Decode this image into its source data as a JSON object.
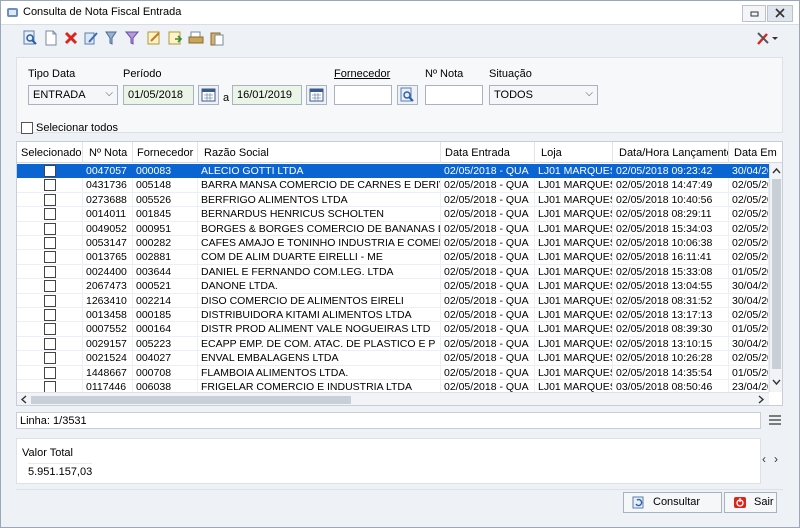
{
  "window": {
    "title": "Consulta de Nota Fiscal Entrada"
  },
  "filters": {
    "tipo_data_label": "Tipo Data",
    "tipo_data_value": "ENTRADA",
    "periodo_label": "Período",
    "periodo_from": "01/05/2018",
    "periodo_sep": "a",
    "periodo_to": "16/01/2019",
    "fornecedor_label": "Fornecedor",
    "fornecedor_value": "",
    "nota_label": "Nº Nota",
    "nota_value": "",
    "situacao_label": "Situação",
    "situacao_value": "TODOS"
  },
  "select_all_label": "Selecionar todos",
  "columns": [
    "Selecionado",
    "Nº Nota",
    "Fornecedor",
    "Razão Social",
    "Data Entrada",
    "Loja",
    "Data/Hora Lançamento",
    "Data Em"
  ],
  "rows": [
    {
      "nota": "0047057",
      "forn": "000083",
      "razao": "ALECIO GOTTI LTDA",
      "entrada": "02/05/2018 - QUA",
      "loja": "LJ01 MARQUES",
      "lanc": "02/05/2018 09:23:42",
      "em": "30/04/20"
    },
    {
      "nota": "0431736",
      "forn": "005148",
      "razao": "BARRA MANSA COMERCIO DE CARNES E DERIVAD",
      "entrada": "02/05/2018 - QUA",
      "loja": "LJ01 MARQUES",
      "lanc": "02/05/2018 14:47:49",
      "em": "02/05/20"
    },
    {
      "nota": "0273688",
      "forn": "005526",
      "razao": "BERFRIGO ALIMENTOS LTDA",
      "entrada": "02/05/2018 - QUA",
      "loja": "LJ01 MARQUES",
      "lanc": "02/05/2018 10:40:56",
      "em": "02/05/20"
    },
    {
      "nota": "0014011",
      "forn": "001845",
      "razao": "BERNARDUS HENRICUS SCHOLTEN",
      "entrada": "02/05/2018 - QUA",
      "loja": "LJ01 MARQUES",
      "lanc": "02/05/2018 08:29:11",
      "em": "02/05/20"
    },
    {
      "nota": "0049052",
      "forn": "000951",
      "razao": "BORGES & BORGES COMERCIO DE BANANAS LTDA",
      "entrada": "02/05/2018 - QUA",
      "loja": "LJ01 MARQUES",
      "lanc": "02/05/2018 15:34:03",
      "em": "02/05/20"
    },
    {
      "nota": "0053147",
      "forn": "000282",
      "razao": "CAFES AMAJO E TONINHO INDUSTRIA E COMERC",
      "entrada": "02/05/2018 - QUA",
      "loja": "LJ01 MARQUES",
      "lanc": "02/05/2018 10:06:38",
      "em": "02/05/20"
    },
    {
      "nota": "0013765",
      "forn": "002881",
      "razao": "COM DE ALIM DUARTE EIRELLI - ME",
      "entrada": "02/05/2018 - QUA",
      "loja": "LJ01 MARQUES",
      "lanc": "02/05/2018 16:11:41",
      "em": "02/05/20"
    },
    {
      "nota": "0024400",
      "forn": "003644",
      "razao": "DANIEL E FERNANDO COM.LEG. LTDA",
      "entrada": "02/05/2018 - QUA",
      "loja": "LJ01 MARQUES",
      "lanc": "02/05/2018 15:33:08",
      "em": "01/05/20"
    },
    {
      "nota": "2067473",
      "forn": "000521",
      "razao": "DANONE LTDA.",
      "entrada": "02/05/2018 - QUA",
      "loja": "LJ01 MARQUES",
      "lanc": "02/05/2018 13:04:55",
      "em": "30/04/20"
    },
    {
      "nota": "1263410",
      "forn": "002214",
      "razao": "DISO COMERCIO DE ALIMENTOS EIRELI",
      "entrada": "02/05/2018 - QUA",
      "loja": "LJ01 MARQUES",
      "lanc": "02/05/2018 08:31:52",
      "em": "30/04/20"
    },
    {
      "nota": "0013458",
      "forn": "000185",
      "razao": "DISTRIBUIDORA KITAMI ALIMENTOS LTDA",
      "entrada": "02/05/2018 - QUA",
      "loja": "LJ01 MARQUES",
      "lanc": "02/05/2018 13:17:13",
      "em": "02/05/20"
    },
    {
      "nota": "0007552",
      "forn": "000164",
      "razao": "DISTR PROD ALIMENT VALE NOGUEIRAS LTD",
      "entrada": "02/05/2018 - QUA",
      "loja": "LJ01 MARQUES",
      "lanc": "02/05/2018 08:39:30",
      "em": "01/05/20"
    },
    {
      "nota": "0029157",
      "forn": "005223",
      "razao": "ECAPP EMP. DE COM. ATAC. DE PLASTICO E P",
      "entrada": "02/05/2018 - QUA",
      "loja": "LJ01 MARQUES",
      "lanc": "02/05/2018 13:10:15",
      "em": "30/04/20"
    },
    {
      "nota": "0021524",
      "forn": "004027",
      "razao": "ENVAL EMBALAGENS LTDA",
      "entrada": "02/05/2018 - QUA",
      "loja": "LJ01 MARQUES",
      "lanc": "02/05/2018 10:26:28",
      "em": "02/05/20"
    },
    {
      "nota": "1448667",
      "forn": "000708",
      "razao": "FLAMBOIA ALIMENTOS LTDA.",
      "entrada": "02/05/2018 - QUA",
      "loja": "LJ01 MARQUES",
      "lanc": "02/05/2018 14:35:54",
      "em": "01/05/20"
    },
    {
      "nota": "0117446",
      "forn": "006038",
      "razao": "FRIGELAR COMERCIO E INDUSTRIA LTDA",
      "entrada": "02/05/2018 - QUA",
      "loja": "LJ01 MARQUES",
      "lanc": "03/05/2018 08:50:46",
      "em": "23/04/20"
    }
  ],
  "status": {
    "linha": "Linha: 1/3531"
  },
  "total": {
    "label": "Valor Total",
    "value": "5.951.157,03"
  },
  "buttons": {
    "consultar": "Consultar",
    "sair": "Sair"
  },
  "colors": {
    "selection": "#0a64d2",
    "window_bg": "#eef1f5",
    "date_field_bg": "#eaf5e8"
  },
  "icons": [
    "search-icon",
    "new-document-icon",
    "delete-icon",
    "edit-icon",
    "filter-icon",
    "funnel-icon",
    "note-icon",
    "export-icon",
    "print-icon",
    "clipboard-icon",
    "tools-icon",
    "calendar-icon",
    "lookup-icon",
    "refresh-icon",
    "exit-icon"
  ]
}
